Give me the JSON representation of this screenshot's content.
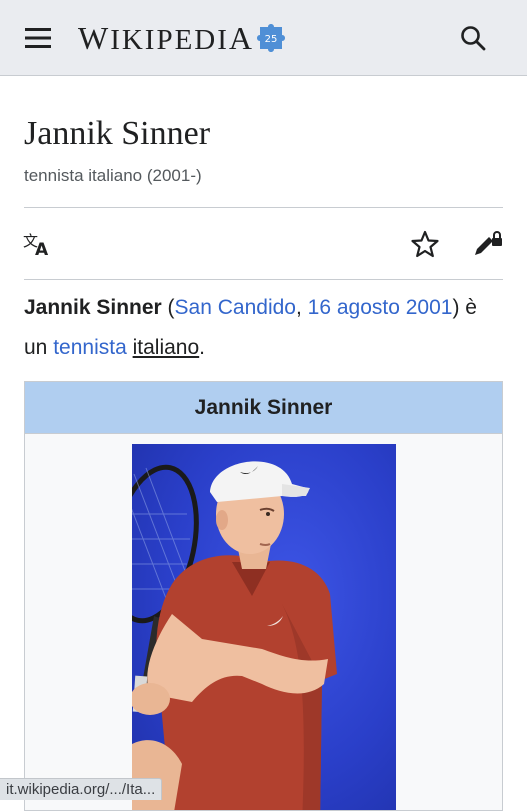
{
  "header": {
    "menu_icon": "hamburger-menu-icon",
    "logo_text_first": "W",
    "logo_text_rest": "IKIPEDI",
    "logo_text_last": "A",
    "logo_badge": "25",
    "search_icon": "search-icon"
  },
  "page": {
    "title": "Jannik Sinner",
    "subtitle": "tennista italiano (2001-)"
  },
  "actions": {
    "language_icon": "language-icon",
    "watch_icon": "star-icon",
    "edit_icon": "edit-locked-icon"
  },
  "lead": {
    "name_bold": "Jannik Sinner",
    "open_paren": " (",
    "birthplace_link": "San Candido",
    "comma": ", ",
    "birthdate_link": "16 agosto",
    "birthyear_link": "2001",
    "after_paren": ") è un ",
    "profession_link": "tennista",
    "space": " ",
    "nationality_link": "italiano",
    "period": "."
  },
  "infobox": {
    "header": "Jannik Sinner",
    "image_alt": "Jannik Sinner"
  },
  "status_bar": {
    "url": "it.wikipedia.org/.../Ita..."
  },
  "colors": {
    "link": "#3366cc",
    "header_bg": "#eaecf0",
    "infobox_header": "#b0cef0",
    "photo_background": "#2a3fc9",
    "shirt": "#b2412f"
  }
}
